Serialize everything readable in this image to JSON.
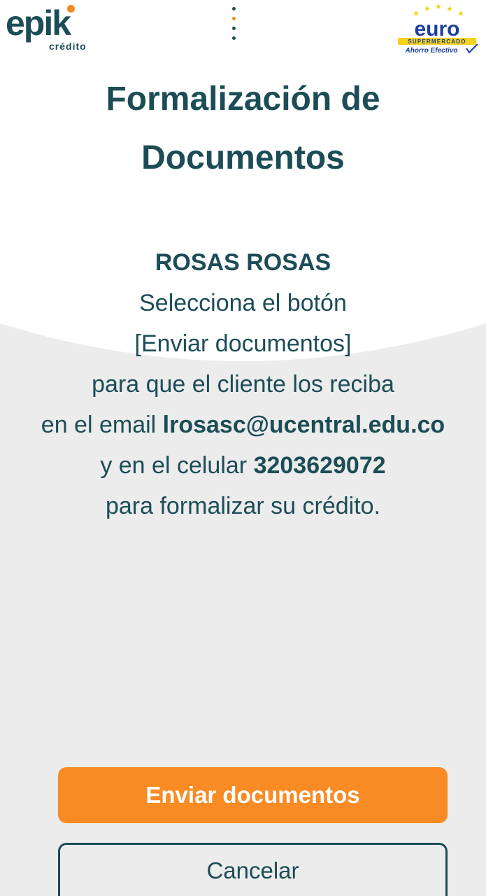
{
  "header": {
    "left_logo": {
      "word": "epik",
      "subtitle": "crédito",
      "icon": "epik-logo"
    },
    "menu_icon": "vertical-dots-icon",
    "right_logo": {
      "word": "euro",
      "tagline": "SUPERMERCADO",
      "slogan": "Ahorro Efectivo",
      "icon": "euro-supermercado-logo"
    }
  },
  "page": {
    "title_line1": "Formalización de",
    "title_line2": "Documentos"
  },
  "message": {
    "name": "ROSAS ROSAS",
    "line1": "Selecciona el botón",
    "line2": "[Enviar documentos]",
    "line3": "para que el cliente los reciba",
    "email_prefix": "en el email ",
    "email": "lrosasc@ucentral.edu.co",
    "phone_prefix": "y en el celular ",
    "phone": "3203629072",
    "line_last": "para formalizar su crédito."
  },
  "actions": {
    "send_label": "Enviar documentos",
    "cancel_label": "Cancelar"
  },
  "colors": {
    "primary_teal": "#1c4d57",
    "accent_orange": "#f88b24",
    "background": "#ececec",
    "euro_blue": "#1c3f9e",
    "euro_yellow": "#f5d21c"
  }
}
